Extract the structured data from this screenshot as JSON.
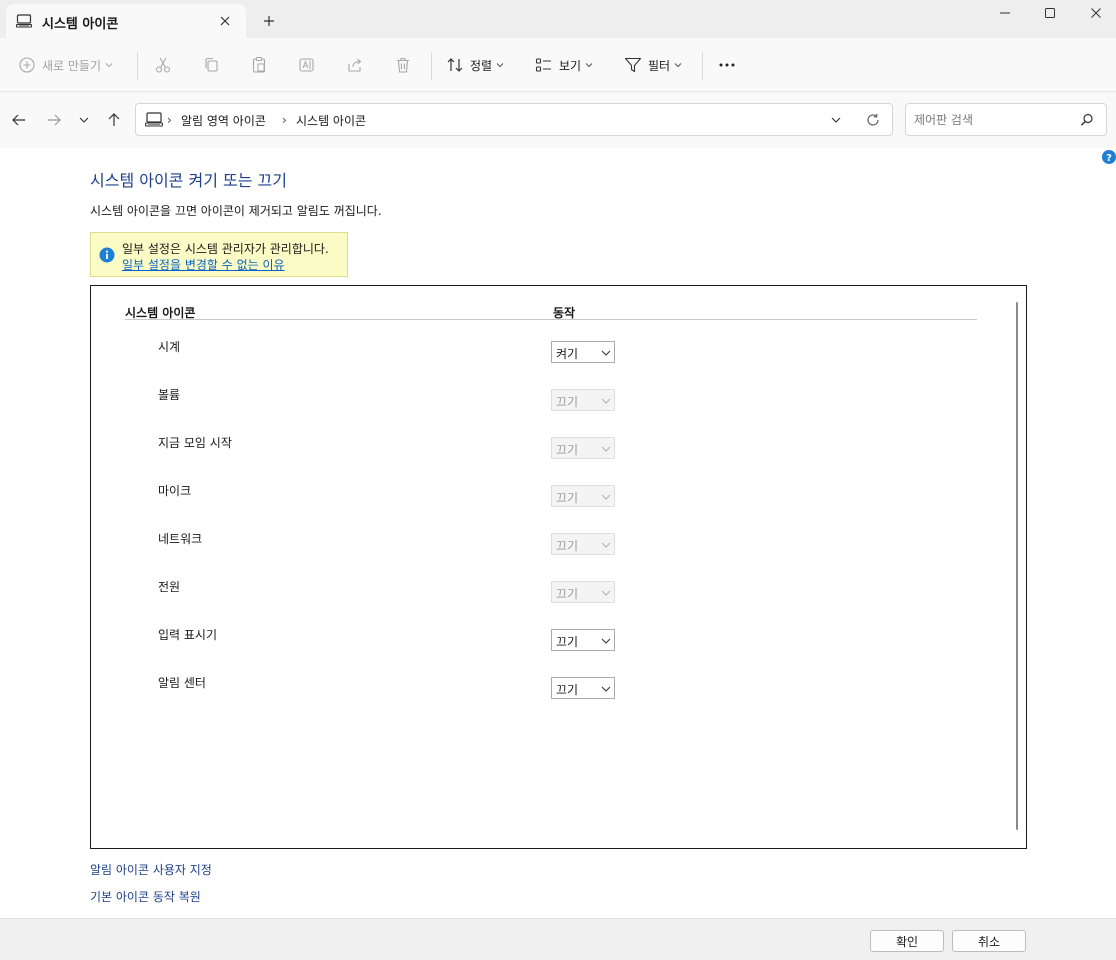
{
  "tab": {
    "title": "시스템 아이콘"
  },
  "commandbar": {
    "new_label": "새로 만들기",
    "sort_label": "정렬",
    "view_label": "보기",
    "filter_label": "필터",
    "more_label": "···"
  },
  "address": {
    "crumbs": [
      "알림 영역 아이콘",
      "시스템 아이콘"
    ],
    "separator": "›"
  },
  "search": {
    "placeholder": "제어판 검색"
  },
  "content": {
    "heading": "시스템 아이콘 켜기 또는 끄기",
    "description": "시스템 아이콘을 끄면 아이콘이 제거되고 알림도 꺼집니다.",
    "notice": {
      "text": "일부 설정은 시스템 관리자가 관리합니다.",
      "link": "일부 설정을 변경할 수 없는 이유"
    },
    "table": {
      "col_icon": "시스템 아이콘",
      "col_behavior": "동작",
      "rows": [
        {
          "name": "시계",
          "value": "켜기",
          "enabled": true
        },
        {
          "name": "볼륨",
          "value": "끄기",
          "enabled": false
        },
        {
          "name": "지금 모임 시작",
          "value": "끄기",
          "enabled": false
        },
        {
          "name": "마이크",
          "value": "끄기",
          "enabled": false
        },
        {
          "name": "네트워크",
          "value": "끄기",
          "enabled": false
        },
        {
          "name": "전원",
          "value": "끄기",
          "enabled": false
        },
        {
          "name": "입력 표시기",
          "value": "끄기",
          "enabled": true
        },
        {
          "name": "알림 센터",
          "value": "끄기",
          "enabled": true
        }
      ]
    },
    "links": {
      "customize": "알림 아이콘 사용자 지정",
      "restore": "기본 아이콘 동작 복원"
    }
  },
  "footer": {
    "ok_label": "확인",
    "cancel_label": "취소"
  },
  "colors": {
    "heading": "#1e3f8c",
    "link": "#0b63c4",
    "notice_bg": "#fbfbc5",
    "info_icon": "#1f7fd6"
  }
}
